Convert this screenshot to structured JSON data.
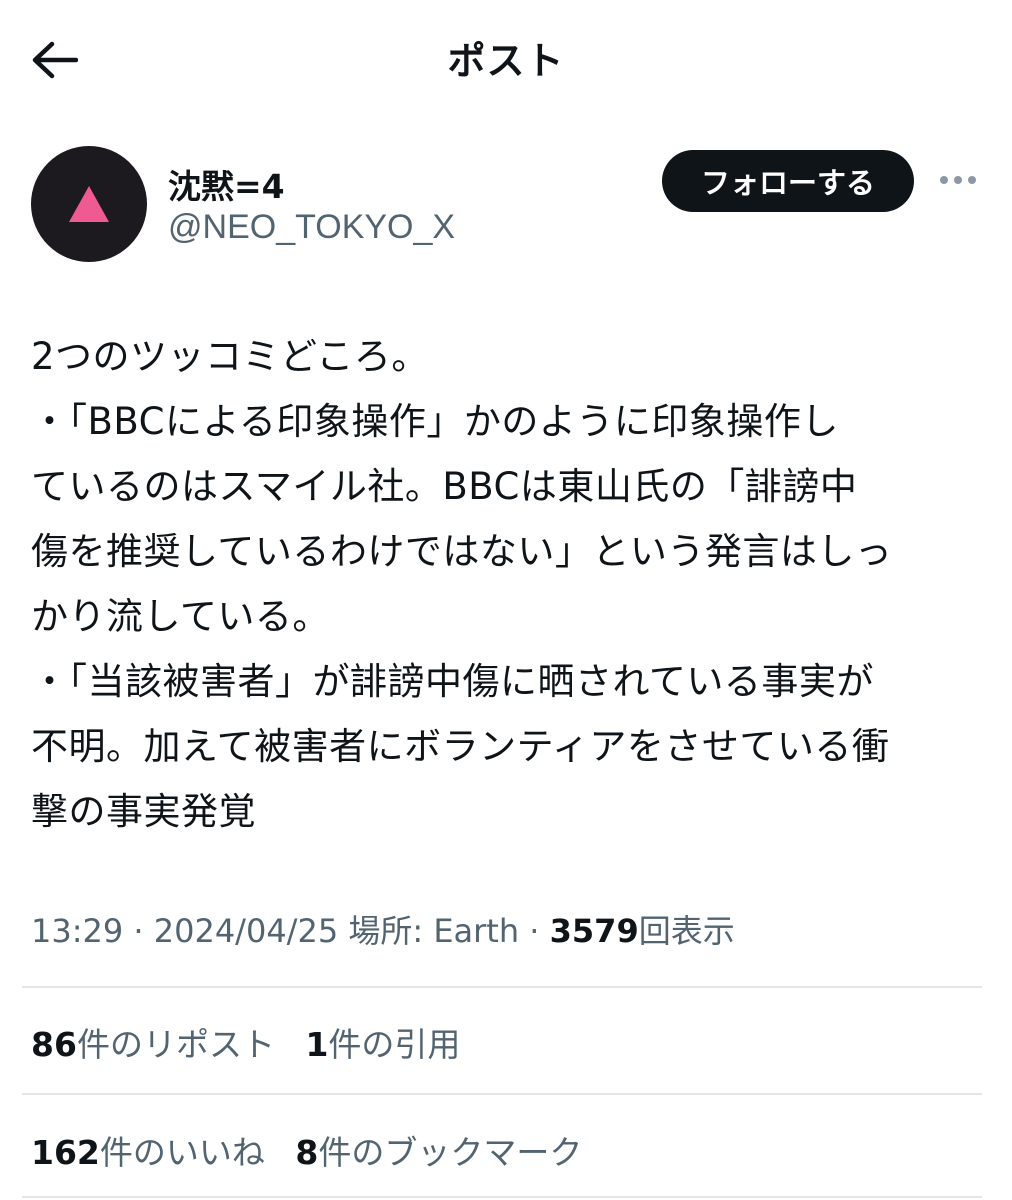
{
  "header": {
    "title": "ポスト"
  },
  "author": {
    "name": "沈黙=4",
    "handle": "@NEO_TOKYO_X",
    "follow_label": "フォローする"
  },
  "post": {
    "lines": [
      "2つのツッコミどころ。",
      "・「BBCによる印象操作」かのように印象操作し",
      "ているのはスマイル社。BBCは東山氏の「誹謗中",
      "傷を推奨しているわけではない」という発言はしっ",
      "かり流している。",
      "・「当該被害者」が誹謗中傷に晒されている事実が",
      "不明。加えて被害者にボランティアをさせている衝",
      "撃の事実発覚"
    ]
  },
  "meta": {
    "time": "13:29",
    "sep1": "·",
    "date": "2024/04/25",
    "location_label": "場所:",
    "location": "Earth",
    "sep2": "·",
    "views_count": "3579",
    "views_label": "回表示"
  },
  "stats": {
    "reposts_count": "86",
    "reposts_label": "件のリポスト",
    "quotes_count": "1",
    "quotes_label": "件の引用",
    "likes_count": "162",
    "likes_label": "件のいいね",
    "bookmarks_count": "8",
    "bookmarks_label": "件のブックマーク"
  },
  "colors": {
    "text": "#0f1419",
    "secondary": "#536471",
    "avatar_bg": "#1c1a1f",
    "avatar_triangle": "#f05a92",
    "divider": "#e3e6e9"
  }
}
